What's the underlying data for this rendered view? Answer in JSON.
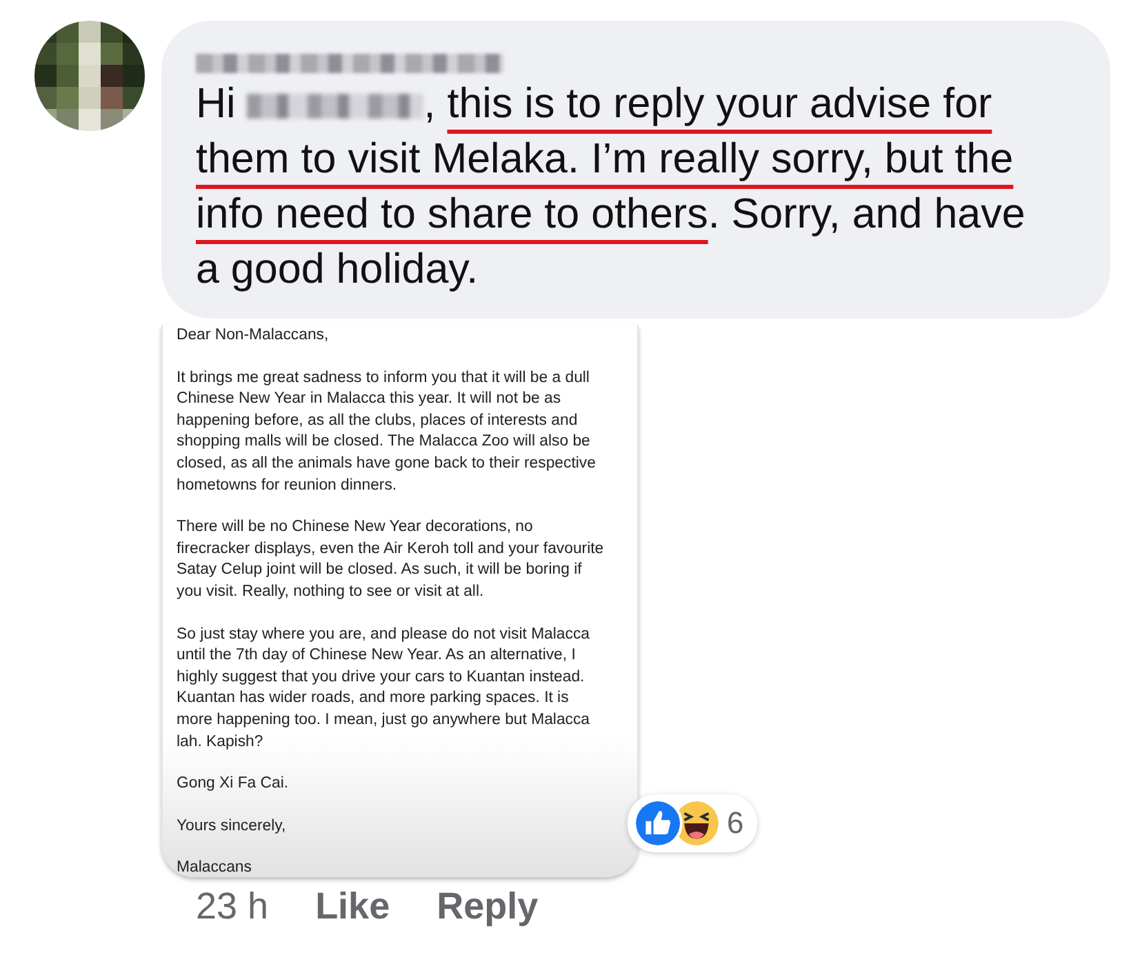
{
  "comment": {
    "author_redacted": true,
    "message": [
      {
        "kind": "text",
        "text": "Hi "
      },
      {
        "kind": "redacted"
      },
      {
        "kind": "text",
        "text": ", "
      },
      {
        "kind": "underlined",
        "text": "this is to reply your advise for them to visit Melaka. I’m really sorry, but the info need to share to others"
      },
      {
        "kind": "text",
        "text": ". Sorry, and have a good holiday."
      }
    ],
    "attachment": {
      "paragraphs": [
        "Dear Non-Malaccans,",
        "It brings me great sadness to inform you that it will be a dull Chinese New Year in Malacca this year. It will not be as happening before, as all the clubs, places of interests and shopping malls will be closed. The Malacca Zoo will also be closed, as all the animals have gone back to their respective hometowns for reunion dinners.",
        "There will be no Chinese New Year decorations, no firecracker displays, even the Air Keroh toll and your favourite Satay Celup joint will be closed. As such, it will be boring if you visit. Really, nothing to see or visit at all.",
        "So just stay where you are, and please do not visit Malacca until the 7th day of Chinese New Year. As an alternative, I highly suggest that you drive your cars to Kuantan instead. Kuantan has wider roads, and more parking spaces. It is more happening too. I mean, just go anywhere but Malacca lah. Kapish?",
        "Gong Xi Fa Cai.",
        "Yours sincerely,",
        "Malaccans"
      ]
    },
    "reactions": {
      "types": [
        {
          "kind": "like"
        },
        {
          "kind": "haha"
        }
      ],
      "count": "6"
    },
    "time": "23 h",
    "actions": [
      "Like",
      "Reply"
    ]
  }
}
